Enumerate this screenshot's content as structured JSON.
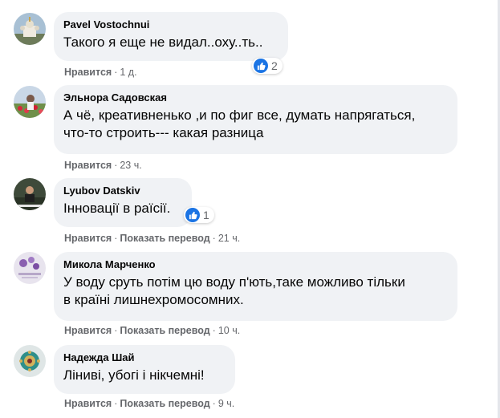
{
  "comments": [
    {
      "author": "Pavel Vostochnui",
      "text": "Такого я еще не видал..оху..ть..",
      "like_label": "Нравится",
      "translate_label": "",
      "time": "1 д.",
      "reactions": "2",
      "avatar_icon": "church-photo-avatar"
    },
    {
      "author": "Эльнора Садовская",
      "text": "А чё, креативненько ,и по фиг все, думать напрягаться,\nчто-то строить--- какая разница",
      "like_label": "Нравится",
      "translate_label": "",
      "time": "23 ч.",
      "reactions": "",
      "avatar_icon": "flower-field-avatar"
    },
    {
      "author": "Lyubov Datskiv",
      "text": "Інновації в раїсії.",
      "like_label": "Нравится",
      "translate_label": "Показать перевод",
      "time": "21 ч.",
      "reactions": "1",
      "avatar_icon": "person-photo-avatar"
    },
    {
      "author": "Микола Марченко",
      "text": "У воду сруть потім цю воду п'ють,таке можливо тільки\nв країні лишнехромосомних.",
      "like_label": "Нравится",
      "translate_label": "Показать перевод",
      "time": "10 ч.",
      "reactions": "",
      "avatar_icon": "flowers-card-avatar"
    },
    {
      "author": "Надежда Шай",
      "text": "Ліниві, убогі і нікчемні!",
      "like_label": "Нравится",
      "translate_label": "Показать перевод",
      "time": "9 ч.",
      "reactions": "",
      "avatar_icon": "brooch-avatar"
    }
  ],
  "colors": {
    "bubble": "#f0f2f5",
    "meta_text": "#65676b",
    "like_blue": "#1b74e4"
  }
}
